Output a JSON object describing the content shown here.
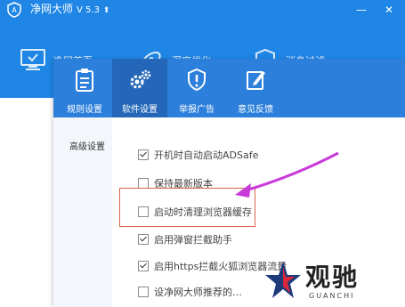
{
  "window": {
    "title": "净网大师",
    "version": "V 5.3",
    "minimize": "—",
    "close": "✕"
  },
  "topnav": {
    "items": [
      {
        "label": "净网首页",
        "icon": "monitor-icon"
      },
      {
        "label": "深度优化",
        "icon": "rocket-icon"
      },
      {
        "label": "消息过滤",
        "icon": "shield-icon"
      }
    ]
  },
  "dialog": {
    "tabs": [
      {
        "label": "规则设置",
        "icon": "clipboard-icon"
      },
      {
        "label": "软件设置",
        "icon": "gears-icon",
        "active": true
      },
      {
        "label": "举报广告",
        "icon": "shield-alert-icon"
      },
      {
        "label": "意见反馈",
        "icon": "edit-icon"
      }
    ],
    "sidebar": {
      "items": [
        {
          "label": "高级设置"
        }
      ]
    },
    "options": [
      {
        "label": "开机时自动启动ADSafe",
        "checked": true
      },
      {
        "label": "保持最新版本",
        "checked": false
      },
      {
        "label": "启动时清理浏览器缓存",
        "checked": false
      },
      {
        "label": "启用弹窗拦截助手",
        "checked": true
      },
      {
        "label": "启用https拦截火狐浏览器流量",
        "checked": true
      },
      {
        "label": "设净网大师推荐的…",
        "checked": false
      }
    ]
  },
  "watermark": {
    "text": "观驰",
    "subtext": "GUANCHI"
  },
  "colors": {
    "titlebar": "#1f86e6",
    "tabbar": "#2c7fda",
    "tab_active": "#2467b8",
    "highlight": "#d9634a",
    "arrow": "#c93bd8"
  }
}
